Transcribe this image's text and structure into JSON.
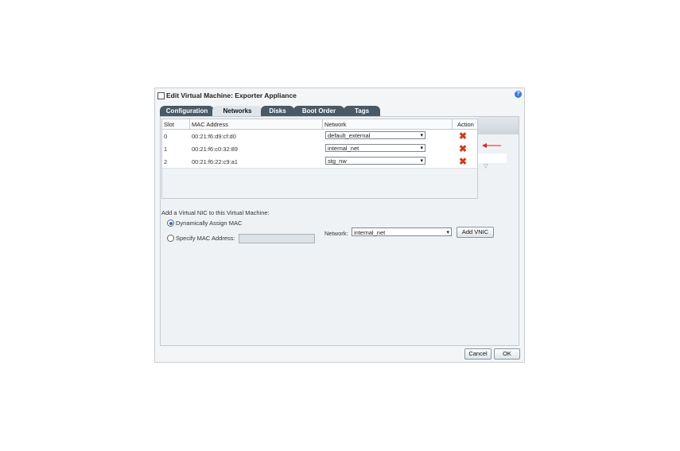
{
  "dialog": {
    "title": "Edit Virtual Machine: Exporter Appliance",
    "help": "?"
  },
  "tabs": [
    {
      "label": "Configuration",
      "active": false
    },
    {
      "label": "Networks",
      "active": true
    },
    {
      "label": "Disks",
      "active": false
    },
    {
      "label": "Boot Order",
      "active": false
    },
    {
      "label": "Tags",
      "active": false
    }
  ],
  "table": {
    "headers": {
      "slot": "Slot",
      "mac": "MAC Address",
      "network": "Network",
      "action": "Action"
    },
    "rows": [
      {
        "slot": "0",
        "mac": "00:21:f6:d9:cf:d0",
        "network": "default_external",
        "action": "✖"
      },
      {
        "slot": "1",
        "mac": "00:21:f6:c0:32:89",
        "network": "internal_net",
        "action": "✖"
      },
      {
        "slot": "2",
        "mac": "00:21:f6:22:c9:a1",
        "network": "stg_nw",
        "action": "✖"
      }
    ]
  },
  "add_vnic": {
    "heading": "Add a Virtual NIC to this Virtual Machine:",
    "dynamic_label": "Dynamically Assign MAC",
    "dynamic_selected": true,
    "specify_label": "Specify MAC Address:",
    "specify_selected": false,
    "mac_value": "",
    "network_label": "Network:",
    "network_value": "internal_net",
    "add_button": "Add VNIC"
  },
  "footer": {
    "cancel": "Cancel",
    "ok": "OK"
  },
  "colors": {
    "tab_dark": "#4a5966",
    "delete_red": "#d23a1a",
    "arrow_red": "#cc2a2a"
  },
  "icons": {
    "caret": "▾",
    "collapse": "▽"
  }
}
